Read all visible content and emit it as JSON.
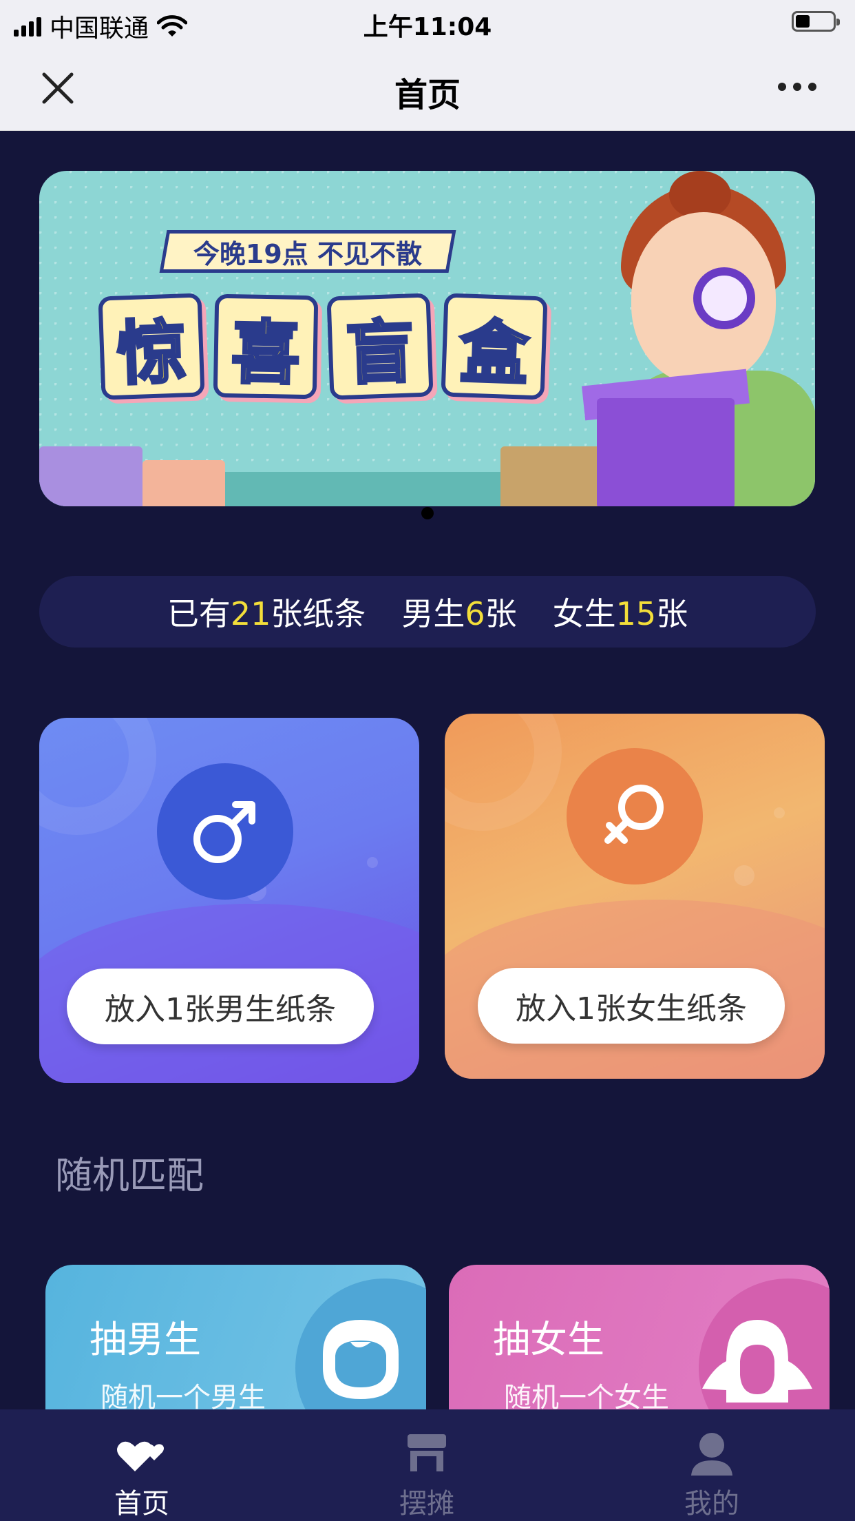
{
  "status_bar": {
    "carrier": "中国联通",
    "time": "上午11:04"
  },
  "nav": {
    "title": "首页"
  },
  "banner": {
    "subtitle": "今晚19点 不见不散",
    "title_chars": [
      "惊",
      "喜",
      "盲",
      "盒"
    ]
  },
  "stats": {
    "total_prefix": "已有",
    "total_count": "21",
    "total_suffix": "张纸条",
    "male_prefix": "男生",
    "male_count": "6",
    "male_suffix": "张",
    "female_prefix": "女生",
    "female_count": "15",
    "female_suffix": "张"
  },
  "put_cards": {
    "male_button": "放入1张男生纸条",
    "female_button": "放入1张女生纸条"
  },
  "random": {
    "section_title": "随机匹配",
    "boy": {
      "title": "抽男生",
      "subtitle": "随机一个男生"
    },
    "girl": {
      "title": "抽女生",
      "subtitle": "随机一个女生"
    }
  },
  "tabbar": {
    "items": [
      {
        "label": "首页",
        "icon": "hearts-icon",
        "active": true
      },
      {
        "label": "摆摊",
        "icon": "stall-icon",
        "active": false
      },
      {
        "label": "我的",
        "icon": "user-icon",
        "active": false
      }
    ]
  },
  "colors": {
    "background": "#14153a",
    "accent_number": "#f3de3a",
    "male": "#6b7cf0",
    "female": "#f09a5a"
  }
}
